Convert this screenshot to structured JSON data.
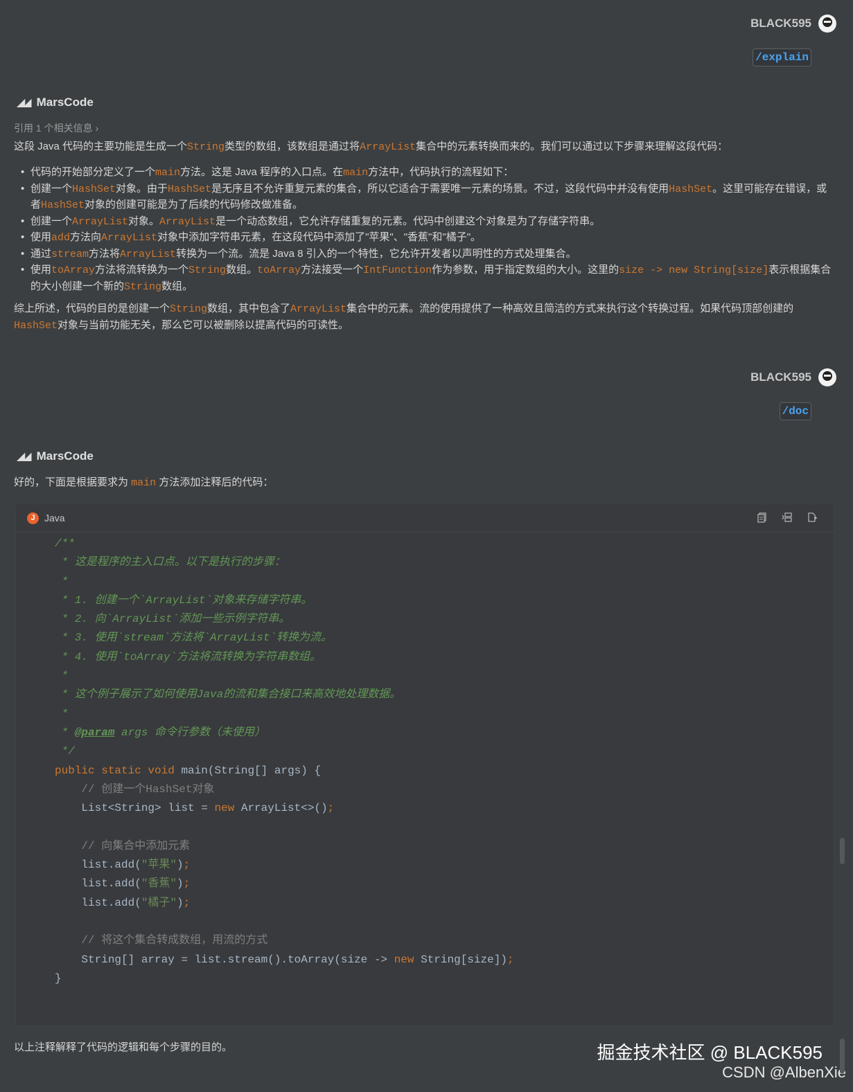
{
  "user": {
    "name": "BLACK595"
  },
  "messages": {
    "cmd1": "/explain",
    "cmd2": "/doc",
    "bot_name": "MarsCode",
    "reference": "引用 1 个相关信息 ›"
  },
  "explain": {
    "intro": [
      "这段 Java 代码的主要功能是生成一个",
      "String",
      "类型的数组，该数组是通过将",
      "ArrayList",
      "集合中的元素转换而来的。我们可以通过以下步骤来理解这段代码："
    ],
    "bullets": [
      [
        "代码的开始部分定义了一个",
        "main",
        "方法。这是 Java 程序的入口点。在",
        "main",
        "方法中，代码执行的流程如下："
      ],
      [
        "创建一个",
        "HashSet",
        "对象。由于",
        "HashSet",
        "是无序且不允许重复元素的集合，所以它适合于需要唯一元素的场景。不过，这段代码中并没有使用",
        "HashSet",
        "。这里可能存在错误，或者",
        "HashSet",
        "对象的创建可能是为了后续的代码修改做准备。"
      ],
      [
        "创建一个",
        "ArrayList",
        "对象。",
        "ArrayList",
        "是一个动态数组，它允许存储重复的元素。代码中创建这个对象是为了存储字符串。"
      ],
      [
        "使用",
        "add",
        "方法向",
        "ArrayList",
        "对象中添加字符串元素，在这段代码中添加了\"苹果\"、\"香蕉\"和\"橘子\"。"
      ],
      [
        "通过",
        "stream",
        "方法将",
        "ArrayList",
        "转换为一个流。流是 Java 8 引入的一个特性，它允许开发者以声明性的方式处理集合。"
      ],
      [
        "使用",
        "toArray",
        "方法将流转换为一个",
        "String",
        "数组。",
        "toArray",
        "方法接受一个",
        "IntFunction",
        "作为参数，用于指定数组的大小。这里的",
        "size -> new String[size]",
        "表示根据集合的大小创建一个新的",
        "String",
        "数组。"
      ]
    ],
    "summary": [
      "综上所述，代码的目的是创建一个",
      "String",
      "数组，其中包含了",
      "ArrayList",
      "集合中的元素。流的使用提供了一种高效且简洁的方式来执行这个转换过程。如果代码顶部创建的",
      "HashSet",
      "对象与当前功能无关，那么它可以被删除以提高代码的可读性。"
    ]
  },
  "doc": {
    "intro": [
      "好的，下面是根据要求为 ",
      "main",
      " 方法添加注释后的代码："
    ],
    "code_lang": "Java",
    "footer": "以上注释解释了代码的逻辑和每个步骤的目的。"
  },
  "code_lines": [
    [
      [
        "cm",
        "/**"
      ]
    ],
    [
      [
        "cm",
        " * 这是程序的主入口点。以下是执行的步骤："
      ]
    ],
    [
      [
        "cm",
        " *"
      ]
    ],
    [
      [
        "cm",
        " * 1. 创建一个`ArrayList`对象来存储字符串。"
      ]
    ],
    [
      [
        "cm",
        " * 2. 向`ArrayList`添加一些示例字符串。"
      ]
    ],
    [
      [
        "cm",
        " * 3. 使用`stream`方法将`ArrayList`转换为流。"
      ]
    ],
    [
      [
        "cm",
        " * 4. 使用`toArray`方法将流转换为字符串数组。"
      ]
    ],
    [
      [
        "cm",
        " *"
      ]
    ],
    [
      [
        "cm",
        " * 这个例子展示了如何使用Java的流和集合接口来高效地处理数据。"
      ]
    ],
    [
      [
        "cm",
        " *"
      ]
    ],
    [
      [
        "cm",
        " * "
      ],
      [
        "tag",
        "@param"
      ],
      [
        "cm",
        " args 命令行参数（未使用）"
      ]
    ],
    [
      [
        "cm",
        " */"
      ]
    ],
    [
      [
        "kw",
        "public static void "
      ],
      [
        "",
        "main(String[] args) {"
      ]
    ],
    [
      [
        "lc",
        "    // 创建一个HashSet对象"
      ]
    ],
    [
      [
        "",
        "    List<String> list = "
      ],
      [
        "kw",
        "new "
      ],
      [
        "",
        "ArrayList<>()"
      ],
      [
        "kw",
        ";"
      ]
    ],
    [
      [
        "",
        ""
      ]
    ],
    [
      [
        "lc",
        "    // 向集合中添加元素"
      ]
    ],
    [
      [
        "",
        "    list.add("
      ],
      [
        "st",
        "\"苹果\""
      ],
      [
        "",
        ")"
      ],
      [
        "kw",
        ";"
      ]
    ],
    [
      [
        "",
        "    list.add("
      ],
      [
        "st",
        "\"香蕉\""
      ],
      [
        "",
        ")"
      ],
      [
        "kw",
        ";"
      ]
    ],
    [
      [
        "",
        "    list.add("
      ],
      [
        "st",
        "\"橘子\""
      ],
      [
        "",
        ")"
      ],
      [
        "kw",
        ";"
      ]
    ],
    [
      [
        "",
        ""
      ]
    ],
    [
      [
        "lc",
        "    // 将这个集合转成数组，用流的方式"
      ]
    ],
    [
      [
        "",
        "    String[] array = list.stream().toArray(size -> "
      ],
      [
        "kw",
        "new "
      ],
      [
        "",
        "String[size])"
      ],
      [
        "kw",
        ";"
      ]
    ],
    [
      [
        "",
        "}"
      ]
    ]
  ],
  "watermark": "掘金技术社区 @ BLACK595",
  "csdn": "CSDN @AlbenXie",
  "icons": [
    "copy-icon",
    "insert-icon",
    "new-file-icon",
    "avatar",
    "marscode-logo",
    "java-badge"
  ]
}
